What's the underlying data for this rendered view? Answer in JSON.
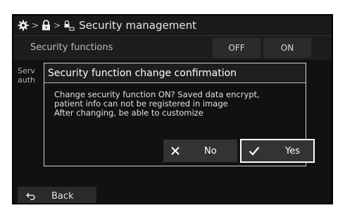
{
  "breadcrumb": {
    "gear_icon": "gear-icon",
    "lock_icon": "lock-icon",
    "security_icon": "lock-card-icon",
    "title": "Security management"
  },
  "settings": {
    "security_functions_label": "Security functions",
    "off_label": "OFF",
    "on_label": "ON",
    "service_row_label": "Serv\nauth"
  },
  "dialog": {
    "title": "Security function change confirmation",
    "message_lines": [
      "Change security function ON? Saved data encrypt,",
      "patient info can not be registered in image",
      "After changing, be able to customize"
    ],
    "no_label": "No",
    "yes_label": "Yes"
  },
  "footer": {
    "back_label": "Back"
  },
  "colors": {
    "background": "#111111",
    "selected_border": "#ffffff"
  }
}
